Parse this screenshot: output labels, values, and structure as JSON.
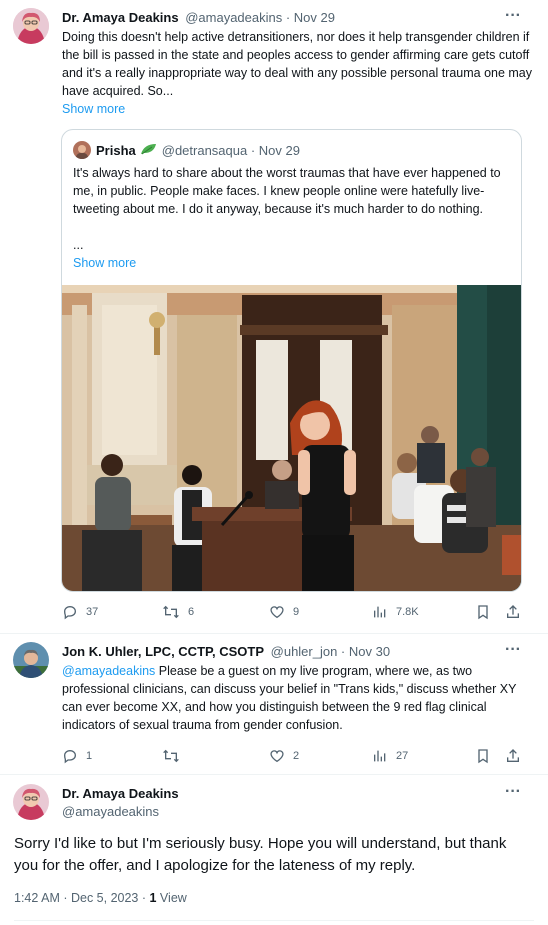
{
  "tweet1": {
    "author_name": "Dr. Amaya Deakins",
    "handle_time": "@amayadeakins · Nov 29",
    "text": "Doing this doesn't help active detransitioners, nor does it help transgender children if the bill is passed in the state and peoples access to gender affirming care gets cutoff and it's a really inappropriate way to deal with any possible personal trauma one may have acquired. So...",
    "show_more": "Show more",
    "quote": {
      "author_name": "Prisha",
      "handle_time": "@detransaqua · Nov 29",
      "text": "It's always hard to share about the worst traumas that have ever happened to me, in public. People make faces. I knew people online were hatefully live-tweeting about me. I do it anyway, because it's much harder to do nothing.",
      "ellipsis": "...",
      "show_more": "Show more"
    },
    "stats": {
      "replies": "37",
      "retweets": "6",
      "likes": "9",
      "views": "7.8K"
    }
  },
  "tweet2": {
    "author_name": "Jon K. Uhler, LPC, CCTP, CSOTP",
    "handle_time": "@uhler_jon · Nov 30",
    "mention": "@amayadeakins",
    "text": " Please be a guest on my live program, where we, as two professional clinicians, can discuss your belief in \"Trans kids,\" discuss whether XY can ever become XX, and how you distinguish between the 9 red flag clinical indicators of sexual trauma from gender confusion.",
    "stats": {
      "replies": "1",
      "retweets": "",
      "likes": "2",
      "views": "27"
    }
  },
  "tweet3": {
    "author_name": "Dr. Amaya Deakins",
    "handle": "@amayadeakins",
    "text": "Sorry I'd like to but I'm seriously busy. Hope you will understand, but thank you for the offer, and I apologize for the lateness of my reply.",
    "timestamp": "1:42 AM · Dec 5, 2023 · ",
    "view_count": "1",
    "view_label": " View"
  },
  "ui": {
    "more_label": "···"
  },
  "colors": {
    "accent": "#1d9bf0",
    "muted": "#536471",
    "border": "#cfd9de"
  },
  "icons": [
    "more-icon",
    "reply-icon",
    "retweet-icon",
    "like-icon",
    "views-icon",
    "bookmark-icon",
    "share-icon",
    "leaf-emoji-icon"
  ]
}
